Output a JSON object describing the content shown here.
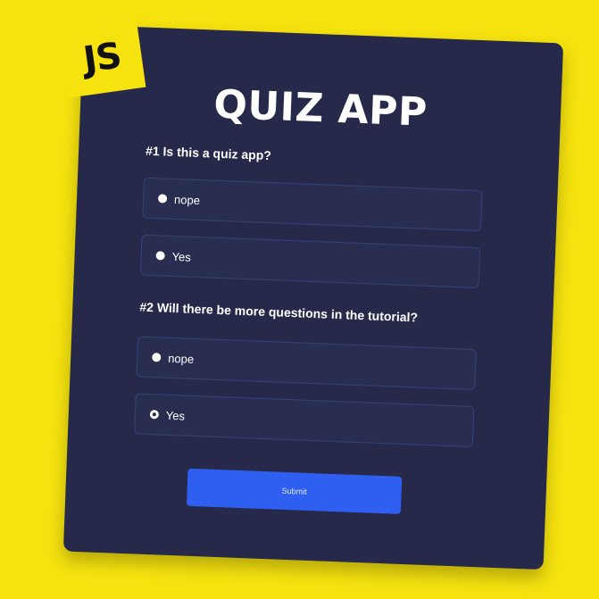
{
  "app": {
    "title": "QUIZ APP",
    "logo_text": "JS"
  },
  "questions": [
    {
      "text": "#1 Is this a quiz app?",
      "options": [
        {
          "label": "nope",
          "checked": false
        },
        {
          "label": "Yes",
          "checked": false
        }
      ]
    },
    {
      "text": "#2 Will there be more questions in the tutorial?",
      "options": [
        {
          "label": "nope",
          "checked": false
        },
        {
          "label": "Yes",
          "checked": true
        }
      ]
    }
  ],
  "submit_label": "Submit",
  "colors": {
    "background": "#f5e20f",
    "card": "#26294a",
    "option_border": "#35427a",
    "button": "#2f5ff0"
  }
}
